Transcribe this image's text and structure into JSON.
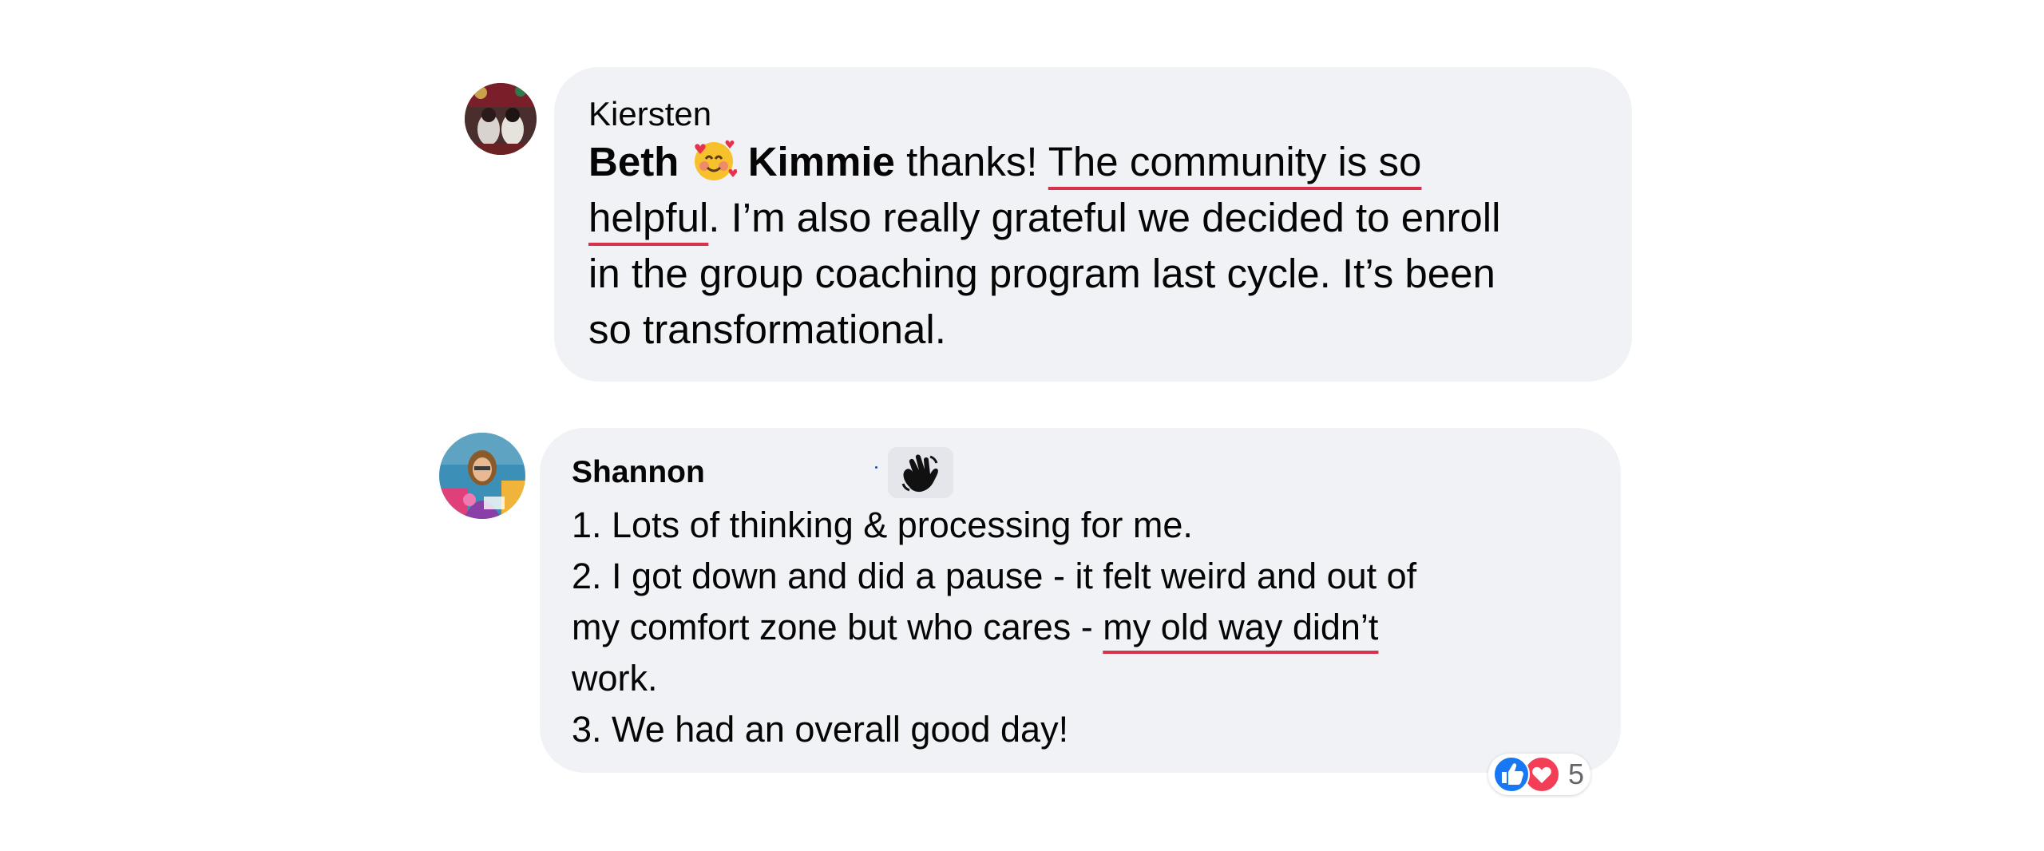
{
  "comments": [
    {
      "author": "Kiersten",
      "mention_1": "Beth",
      "mention_2": "Kimmie",
      "text_after_mentions": " thanks! ",
      "underlined_1": "The community is so",
      "underlined_2": "helpful",
      "line_2_rest": ". I’m also really grateful we decided to enroll",
      "line_3": "in the group coaching program last cycle. It’s been",
      "line_4": "so transformational."
    },
    {
      "author": "Shannon",
      "line_1": "1. Lots of thinking & processing for me.",
      "line_2": "2. I got down and did a pause - it felt weird and out of",
      "line_3_start": "my comfort zone but who cares - ",
      "line_3_underlined": "my old way didn’t",
      "line_4": "work.",
      "line_5": "3. We had an overall good day!",
      "reaction_count": "5"
    }
  ],
  "colors": {
    "bubble": "#f0f2f5",
    "underline": "#d6324c",
    "like_blue": "#1877f2",
    "love_red": "#f33e58"
  },
  "icons": [
    "avatar-kiersten",
    "smiling-face-with-hearts-emoji",
    "avatar-shannon",
    "waving-hand-icon",
    "like-reaction-icon",
    "love-reaction-icon"
  ]
}
